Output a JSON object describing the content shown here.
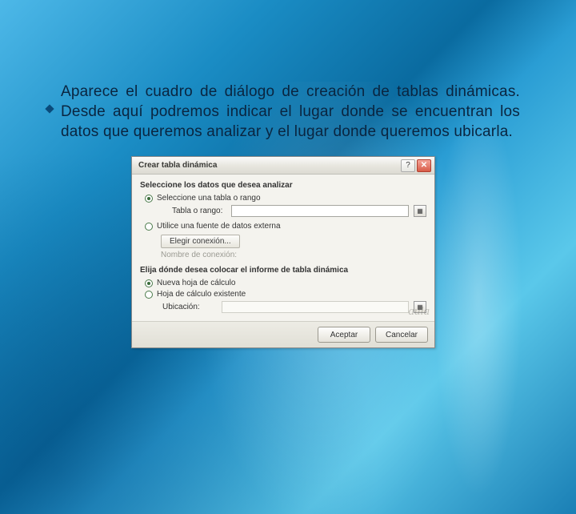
{
  "slide": {
    "paragraph": "Aparece el cuadro de diálogo de creación de tablas dinámicas. Desde aquí podremos indicar el lugar donde se encuentran los datos que queremos analizar y el lugar donde queremos ubicarla."
  },
  "dialog": {
    "title": "Crear tabla dinámica",
    "section1": "Seleccione los datos que desea analizar",
    "radio_select": "Seleccione una tabla o rango",
    "table_range_label": "Tabla o rango:",
    "radio_external": "Utilice una fuente de datos externa",
    "choose_connection": "Elegir conexión...",
    "connection_name_label": "Nombre de conexión:",
    "section2": "Elija dónde desea colocar el informe de tabla dinámica",
    "radio_newsheet": "Nueva hoja de cálculo",
    "radio_existing": "Hoja de cálculo existente",
    "location_label": "Ubicación:",
    "ok": "Aceptar",
    "cancel": "Cancelar"
  },
  "watermark": "aula"
}
